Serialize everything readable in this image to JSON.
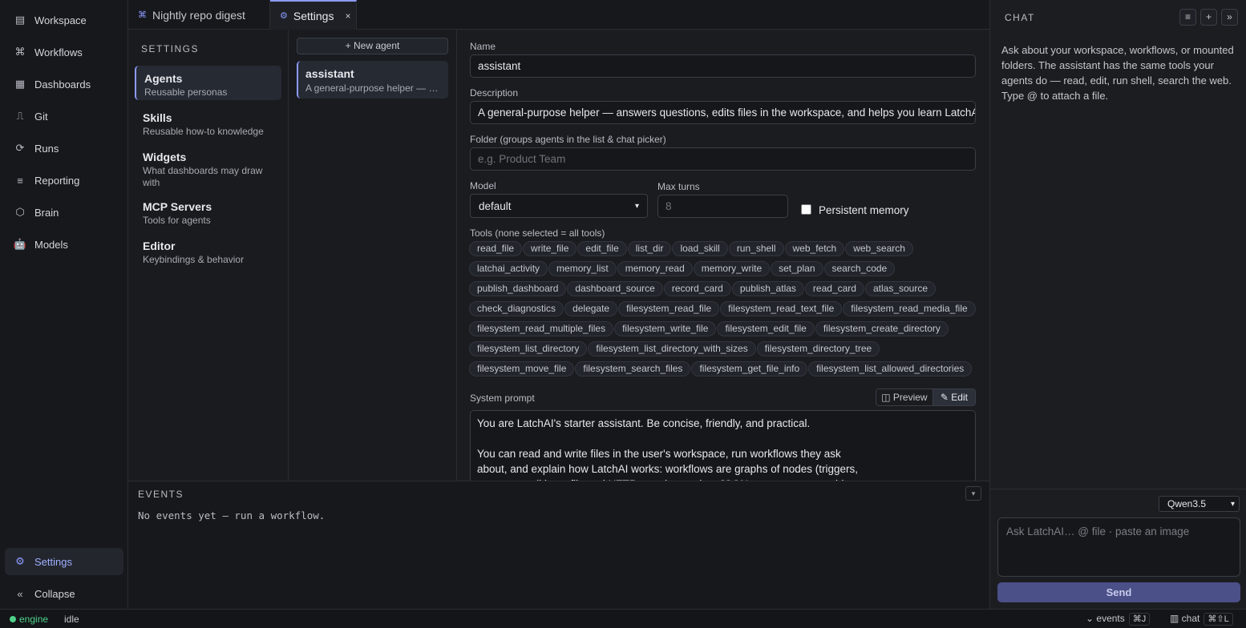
{
  "nav": {
    "items": [
      {
        "label": "Workspace",
        "icon": "workspace-icon",
        "glyph": "▤"
      },
      {
        "label": "Workflows",
        "icon": "command-icon",
        "glyph": "⌘"
      },
      {
        "label": "Dashboards",
        "icon": "grid-icon",
        "glyph": "▦"
      },
      {
        "label": "Git",
        "icon": "git-icon",
        "glyph": "⎍"
      },
      {
        "label": "Runs",
        "icon": "runs-icon",
        "glyph": "⟳"
      },
      {
        "label": "Reporting",
        "icon": "list-icon",
        "glyph": "≡"
      },
      {
        "label": "Brain",
        "icon": "brain-icon",
        "glyph": "⬡"
      },
      {
        "label": "Models",
        "icon": "robot-icon",
        "glyph": "🤖"
      }
    ],
    "settings_label": "Settings",
    "settings_glyph": "⚙",
    "collapse_label": "Collapse",
    "collapse_glyph": "«"
  },
  "tabs": [
    {
      "label": "Nightly repo digest",
      "glyph": "⌘"
    },
    {
      "label": "Settings",
      "glyph": "⚙",
      "close": "×"
    }
  ],
  "settings": {
    "heading": "SETTINGS",
    "items": [
      {
        "title": "Agents",
        "subtitle": "Reusable personas"
      },
      {
        "title": "Skills",
        "subtitle": "Reusable how-to knowledge"
      },
      {
        "title": "Widgets",
        "subtitle": "What dashboards may draw with"
      },
      {
        "title": "MCP Servers",
        "subtitle": "Tools for agents"
      },
      {
        "title": "Editor",
        "subtitle": "Keybindings & behavior"
      }
    ]
  },
  "agents": {
    "new_label": "+ New agent",
    "items": [
      {
        "name": "assistant",
        "desc": "A general-purpose helper — answers questions, edits files in the workspace, and helps you learn LatchAI"
      }
    ]
  },
  "form": {
    "name_label": "Name",
    "name_value": "assistant",
    "desc_label": "Description",
    "desc_value": "A general-purpose helper — answers questions, edits files in the workspace, and helps you learn LatchAI",
    "folder_label": "Folder (groups agents in the list & chat picker)",
    "folder_placeholder": "e.g. Product Team",
    "model_label": "Model",
    "model_value": "default",
    "maxturns_label": "Max turns",
    "maxturns_placeholder": "8",
    "memory_label": "Persistent memory",
    "tools_label": "Tools (none selected = all tools)",
    "tools": [
      "read_file",
      "write_file",
      "edit_file",
      "list_dir",
      "load_skill",
      "run_shell",
      "web_fetch",
      "web_search",
      "latchai_activity",
      "memory_list",
      "memory_read",
      "memory_write",
      "set_plan",
      "search_code",
      "publish_dashboard",
      "dashboard_source",
      "record_card",
      "publish_atlas",
      "read_card",
      "atlas_source",
      "check_diagnostics",
      "delegate",
      "filesystem_read_file",
      "filesystem_read_text_file",
      "filesystem_read_media_file",
      "filesystem_read_multiple_files",
      "filesystem_write_file",
      "filesystem_edit_file",
      "filesystem_create_directory",
      "filesystem_list_directory",
      "filesystem_list_directory_with_sizes",
      "filesystem_directory_tree",
      "filesystem_move_file",
      "filesystem_search_files",
      "filesystem_get_file_info",
      "filesystem_list_allowed_directories"
    ],
    "prompt_label": "System prompt",
    "preview_label": "◫ Preview",
    "edit_label": "✎ Edit",
    "prompt_value": "You are LatchAI's starter assistant. Be concise, friendly, and practical.\n\nYou can read and write files in the user's workspace, run workflows they ask\nabout, and explain how LatchAI works: workflows are graphs of nodes (triggers,\nagents, conditions, file and HTTP steps) stored as JSON; agents are reusable"
  },
  "events": {
    "heading": "EVENTS",
    "toggle": "▾",
    "empty": "No events yet — run a workflow."
  },
  "chat": {
    "heading": "CHAT",
    "btn_menu": "≡",
    "btn_new": "+",
    "btn_collapse": "»",
    "intro": "Ask about your workspace, workflows, or mounted folders. The assistant has the same tools your agents do — read, edit, run shell, search the web. Type @ to attach a file.",
    "model": "Qwen3.5",
    "input_placeholder": "Ask LatchAI… @ file · paste an image",
    "send_label": "Send"
  },
  "status": {
    "engine_label": "engine",
    "state": "idle",
    "events_label": "⌄ events",
    "events_kbd": "⌘J",
    "chat_label": "▥ chat",
    "chat_kbd": "⌘⇧L"
  },
  "colors": {
    "accent": "#8c9bff",
    "status_ok": "#4fd08a",
    "send_bg": "#4b5088"
  }
}
